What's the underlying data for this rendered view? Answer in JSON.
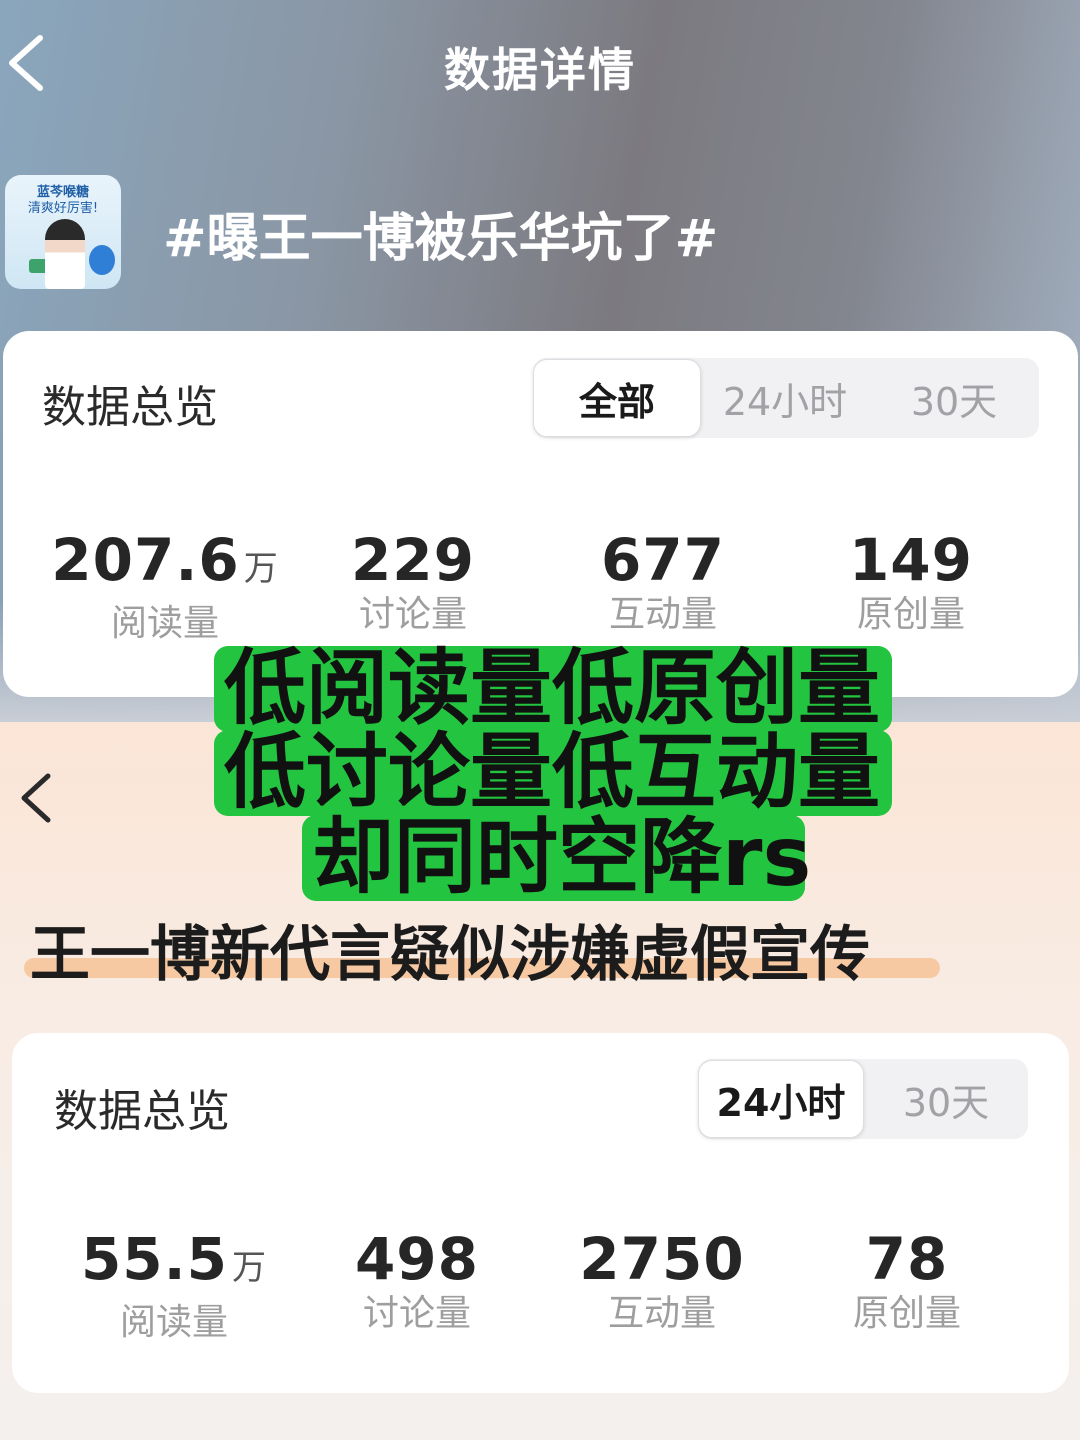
{
  "top": {
    "nav_title": "数据详情",
    "topic_thumb": {
      "line1": "蓝芩喉糖",
      "line2": "清爽好厉害!"
    },
    "topic_title": "#曝王一博被乐华坑了#",
    "card": {
      "title": "数据总览",
      "tabs": [
        "全部",
        "24小时",
        "30天"
      ],
      "active_tab": "全部",
      "stats": [
        {
          "value": "207.6",
          "unit": "万",
          "label": "阅读量"
        },
        {
          "value": "229",
          "unit": "",
          "label": "讨论量"
        },
        {
          "value": "677",
          "unit": "",
          "label": "互动量"
        },
        {
          "value": "149",
          "unit": "",
          "label": "原创量"
        }
      ]
    }
  },
  "overlay": {
    "lines": [
      "低阅读量低原创量",
      "低讨论量低互动量",
      "却同时空降rs"
    ],
    "color": "#23c43f"
  },
  "bottom": {
    "headline": "王一博新代言疑似涉嫌虚假宣传",
    "card": {
      "title": "数据总览",
      "tabs": [
        "24小时",
        "30天"
      ],
      "active_tab": "24小时",
      "stats": [
        {
          "value": "55.5",
          "unit": "万",
          "label": "阅读量"
        },
        {
          "value": "498",
          "unit": "",
          "label": "讨论量"
        },
        {
          "value": "2750",
          "unit": "",
          "label": "互动量"
        },
        {
          "value": "78",
          "unit": "",
          "label": "原创量"
        }
      ]
    }
  },
  "icons": [
    "back-arrow-icon"
  ]
}
